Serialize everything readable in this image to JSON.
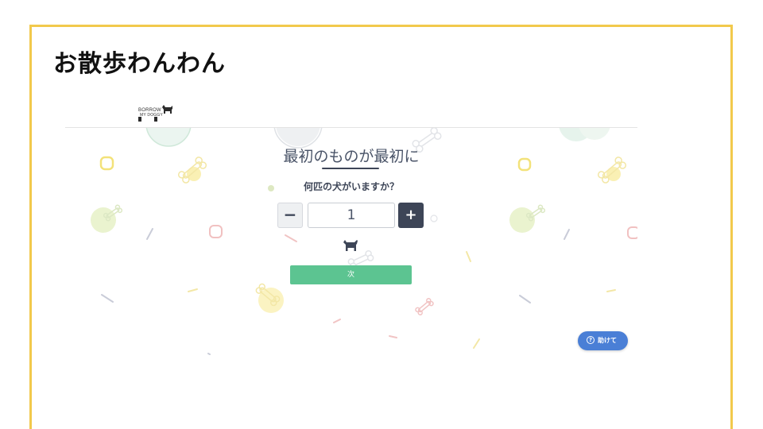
{
  "slide": {
    "title": "お散歩わんわん"
  },
  "app": {
    "logo": {
      "line1": "BORROW",
      "line2": "MY DOGGY"
    },
    "heading": "最初のものが最初に",
    "question": "何匹の犬がいますか？",
    "stepper": {
      "minus_label": "−",
      "value": "1",
      "plus_label": "+"
    },
    "next_label": "次",
    "help_label": "助けて",
    "help_icon_glyph": "?"
  },
  "icons": {
    "logo_dog": "dog-silhouette-icon",
    "count_dog": "dog-icon",
    "help": "question-circle-icon"
  },
  "colors": {
    "frame": "#f2c94c",
    "primary_dark": "#3d4557",
    "next_green": "#5cc491",
    "help_blue": "#4a7fd6"
  }
}
